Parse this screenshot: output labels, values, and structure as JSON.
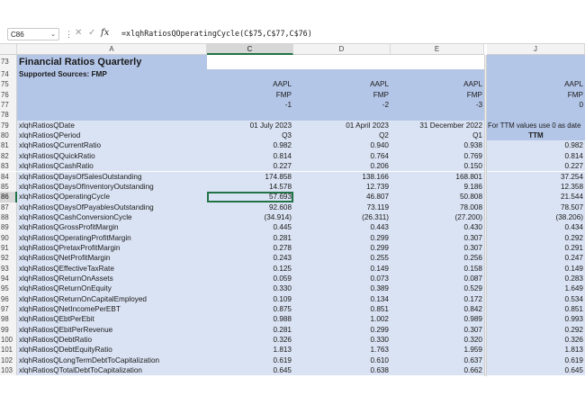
{
  "formula_bar": {
    "name_box": "C86",
    "fx_label": "fx",
    "formula": "=xlqhRatiosQOperatingCycle(C$75,C$77,C$76)"
  },
  "columns": [
    "A",
    "C",
    "D",
    "E",
    "J"
  ],
  "rows": [
    {
      "num": "73",
      "a": "Financial Ratios Quarterly",
      "c": "",
      "d": "",
      "e": "",
      "j": ""
    },
    {
      "num": "74",
      "a": "Supported Sources: FMP",
      "c": "",
      "d": "",
      "e": "",
      "j": ""
    },
    {
      "num": "75",
      "a": "",
      "c": "AAPL",
      "d": "AAPL",
      "e": "AAPL",
      "j": "AAPL"
    },
    {
      "num": "76",
      "a": "",
      "c": "FMP",
      "d": "FMP",
      "e": "FMP",
      "j": "FMP"
    },
    {
      "num": "77",
      "a": "",
      "c": "-1",
      "d": "-2",
      "e": "-3",
      "j": "0"
    },
    {
      "num": "78",
      "a": "",
      "c": "",
      "d": "",
      "e": "",
      "j": ""
    },
    {
      "num": "79",
      "a": "xlqhRatiosQDate",
      "c": "01 July 2023",
      "d": "01 April 2023",
      "e": "31 December 2022",
      "j": "For TTM values use 0 as date"
    },
    {
      "num": "80",
      "a": "xlqhRatiosQPeriod",
      "c": "Q3",
      "d": "Q2",
      "e": "Q1",
      "j": "TTM"
    },
    {
      "num": "81",
      "a": "xlqhRatiosQCurrentRatio",
      "c": "0.982",
      "d": "0.940",
      "e": "0.938",
      "j": "0.982"
    },
    {
      "num": "82",
      "a": "xlqhRatiosQQuickRatio",
      "c": "0.814",
      "d": "0.764",
      "e": "0.769",
      "j": "0.814"
    },
    {
      "num": "83",
      "a": "xlqhRatiosQCashRatio",
      "c": "0.227",
      "d": "0.206",
      "e": "0.150",
      "j": "0.227"
    },
    {
      "num": "84",
      "a": "xlqhRatiosQDaysOfSalesOutstanding",
      "c": "174.858",
      "d": "138.166",
      "e": "168.801",
      "j": "37.254"
    },
    {
      "num": "85",
      "a": "xlqhRatiosQDaysOfInventoryOutstanding",
      "c": "14.578",
      "d": "12.739",
      "e": "9.186",
      "j": "12.358"
    },
    {
      "num": "86",
      "a": "xlqhRatiosQOperatingCycle",
      "c": "57.693",
      "d": "46.807",
      "e": "50.808",
      "j": "21.544"
    },
    {
      "num": "87",
      "a": "xlqhRatiosQDaysOfPayablesOutstanding",
      "c": "92.608",
      "d": "73.119",
      "e": "78.008",
      "j": "78.507"
    },
    {
      "num": "88",
      "a": "xlqhRatiosQCashConversionCycle",
      "c": "(34.914)",
      "d": "(26.311)",
      "e": "(27.200)",
      "j": "(38.206)"
    },
    {
      "num": "89",
      "a": "xlqhRatiosQGrossProfitMargin",
      "c": "0.445",
      "d": "0.443",
      "e": "0.430",
      "j": "0.434"
    },
    {
      "num": "90",
      "a": "xlqhRatiosQOperatingProfitMargin",
      "c": "0.281",
      "d": "0.299",
      "e": "0.307",
      "j": "0.292"
    },
    {
      "num": "91",
      "a": "xlqhRatiosQPretaxProfitMargin",
      "c": "0.278",
      "d": "0.299",
      "e": "0.307",
      "j": "0.291"
    },
    {
      "num": "92",
      "a": "xlqhRatiosQNetProfitMargin",
      "c": "0.243",
      "d": "0.255",
      "e": "0.256",
      "j": "0.247"
    },
    {
      "num": "93",
      "a": "xlqhRatiosQEffectiveTaxRate",
      "c": "0.125",
      "d": "0.149",
      "e": "0.158",
      "j": "0.149"
    },
    {
      "num": "94",
      "a": "xlqhRatiosQReturnOnAssets",
      "c": "0.059",
      "d": "0.073",
      "e": "0.087",
      "j": "0.283"
    },
    {
      "num": "95",
      "a": "xlqhRatiosQReturnOnEquity",
      "c": "0.330",
      "d": "0.389",
      "e": "0.529",
      "j": "1.649"
    },
    {
      "num": "96",
      "a": "xlqhRatiosQReturnOnCapitalEmployed",
      "c": "0.109",
      "d": "0.134",
      "e": "0.172",
      "j": "0.534"
    },
    {
      "num": "97",
      "a": "xlqhRatiosQNetIncomePerEBT",
      "c": "0.875",
      "d": "0.851",
      "e": "0.842",
      "j": "0.851"
    },
    {
      "num": "98",
      "a": "xlqhRatiosQEbtPerEbit",
      "c": "0.988",
      "d": "1.002",
      "e": "0.989",
      "j": "0.993"
    },
    {
      "num": "99",
      "a": "xlqhRatiosQEbitPerRevenue",
      "c": "0.281",
      "d": "0.299",
      "e": "0.307",
      "j": "0.292"
    },
    {
      "num": "100",
      "a": "xlqhRatiosQDebtRatio",
      "c": "0.326",
      "d": "0.330",
      "e": "0.320",
      "j": "0.326"
    },
    {
      "num": "101",
      "a": "xlqhRatiosQDebtEquityRatio",
      "c": "1.813",
      "d": "1.763",
      "e": "1.959",
      "j": "1.813"
    },
    {
      "num": "102",
      "a": "xlqhRatiosQLongTermDebtToCapitalization",
      "c": "0.619",
      "d": "0.610",
      "e": "0.637",
      "j": "0.619"
    },
    {
      "num": "103",
      "a": "xlqhRatiosQTotalDebtToCapitalization",
      "c": "0.645",
      "d": "0.638",
      "e": "0.662",
      "j": "0.645"
    }
  ],
  "colors": {
    "header_blue": "#b4c6e7",
    "body_blue": "#dae3f3",
    "selection": "#217346"
  }
}
